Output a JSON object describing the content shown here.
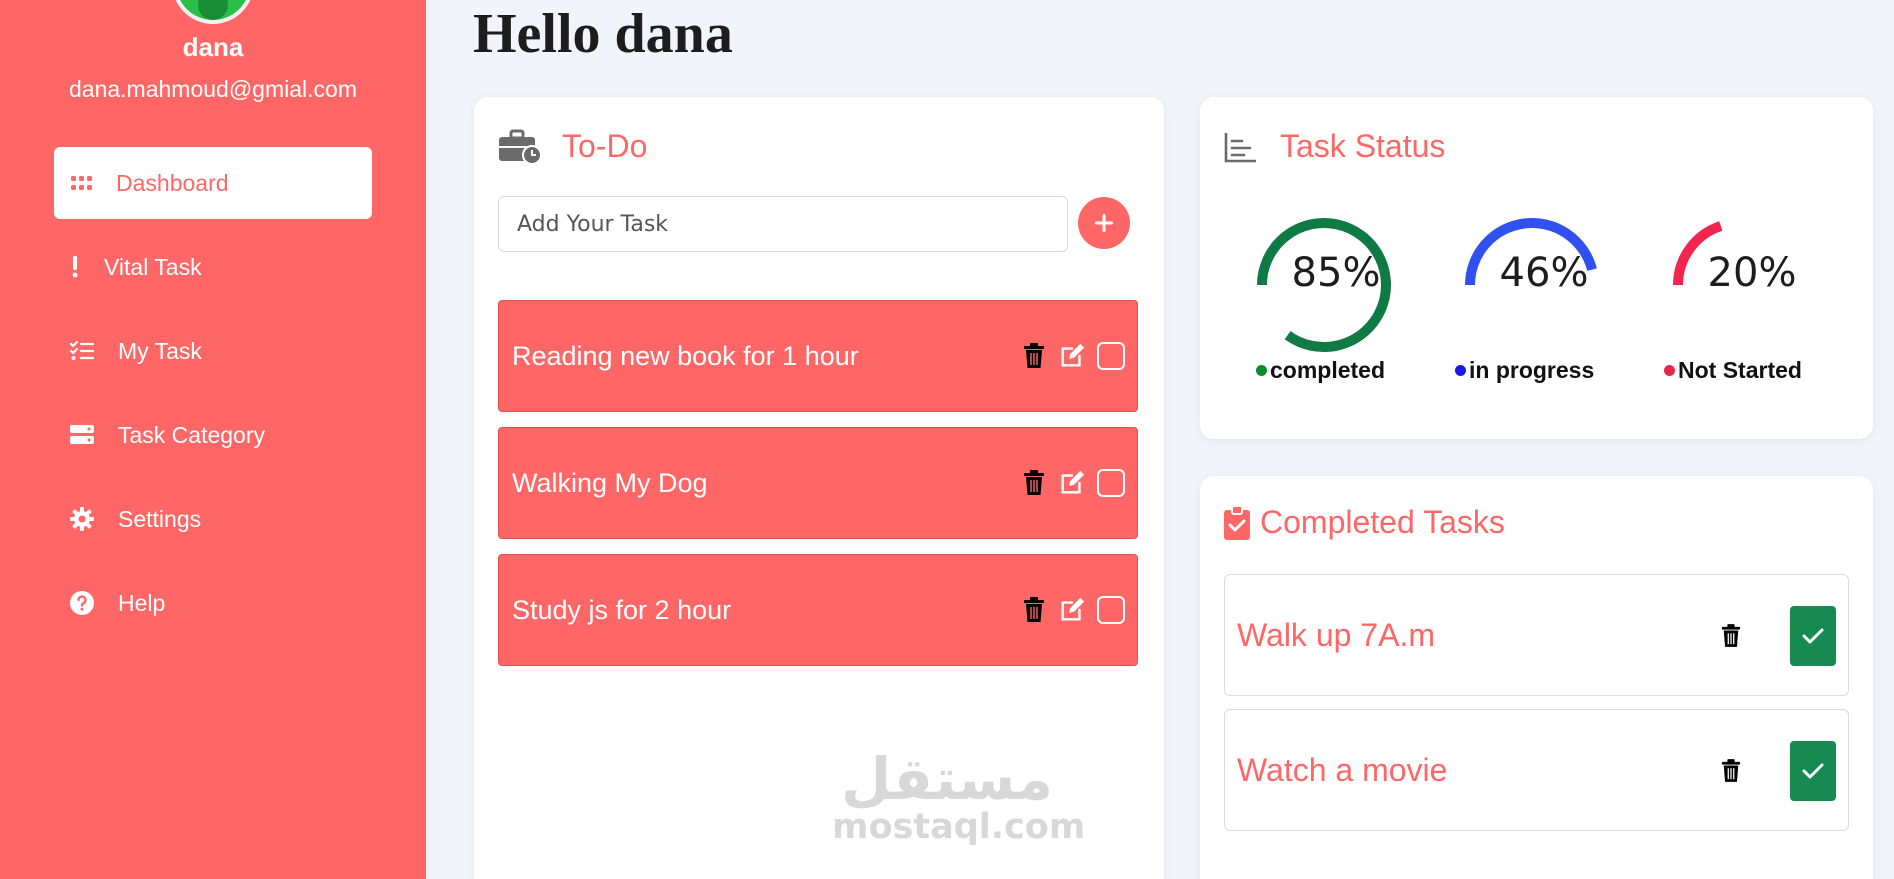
{
  "user": {
    "name": "dana",
    "email": "dana.mahmoud@gmial.com"
  },
  "sidebar": {
    "items": [
      {
        "label": "Dashboard",
        "icon": "grid-icon",
        "active": true
      },
      {
        "label": "Vital Task",
        "icon": "exclamation-icon"
      },
      {
        "label": "My Task",
        "icon": "checklist-icon"
      },
      {
        "label": "Task Category",
        "icon": "category-icon"
      },
      {
        "label": "Settings",
        "icon": "gear-icon"
      },
      {
        "label": "Help",
        "icon": "help-icon"
      }
    ]
  },
  "header": {
    "greeting": "Hello dana"
  },
  "todo": {
    "title": "To-Do",
    "icon": "briefcase-clock-icon",
    "input_placeholder": "Add Your Task",
    "add_icon": "plus-icon",
    "tasks": [
      {
        "text": "Reading new book for 1 hour",
        "checked": false
      },
      {
        "text": "Walking My Dog",
        "checked": false
      },
      {
        "text": "Study js for 2 hour",
        "checked": false
      }
    ]
  },
  "status": {
    "title": "Task Status",
    "icon": "bar-chart-icon",
    "items": [
      {
        "percent": "85%",
        "value": 85,
        "label": "completed",
        "color": "#0f7a43",
        "dot_color": "#0f8a2e"
      },
      {
        "percent": "46%",
        "value": 46,
        "label": "in progress",
        "color": "#3150f0",
        "dot_color": "#1a1ae6"
      },
      {
        "percent": "20%",
        "value": 20,
        "label": "Not Started",
        "color": "#f2254f",
        "dot_color": "#e8244d"
      }
    ]
  },
  "completed": {
    "title": "Completed Tasks",
    "icon": "clipboard-check-icon",
    "items": [
      {
        "text": "Walk up 7A.m",
        "done": true
      },
      {
        "text": "Watch a movie",
        "done": true
      }
    ]
  },
  "watermark": {
    "arabic": "مستقل",
    "latin": "mostaql.com"
  },
  "colors": {
    "accent": "#ff6767",
    "background": "#f1f4fb",
    "done_green": "#178a52"
  }
}
